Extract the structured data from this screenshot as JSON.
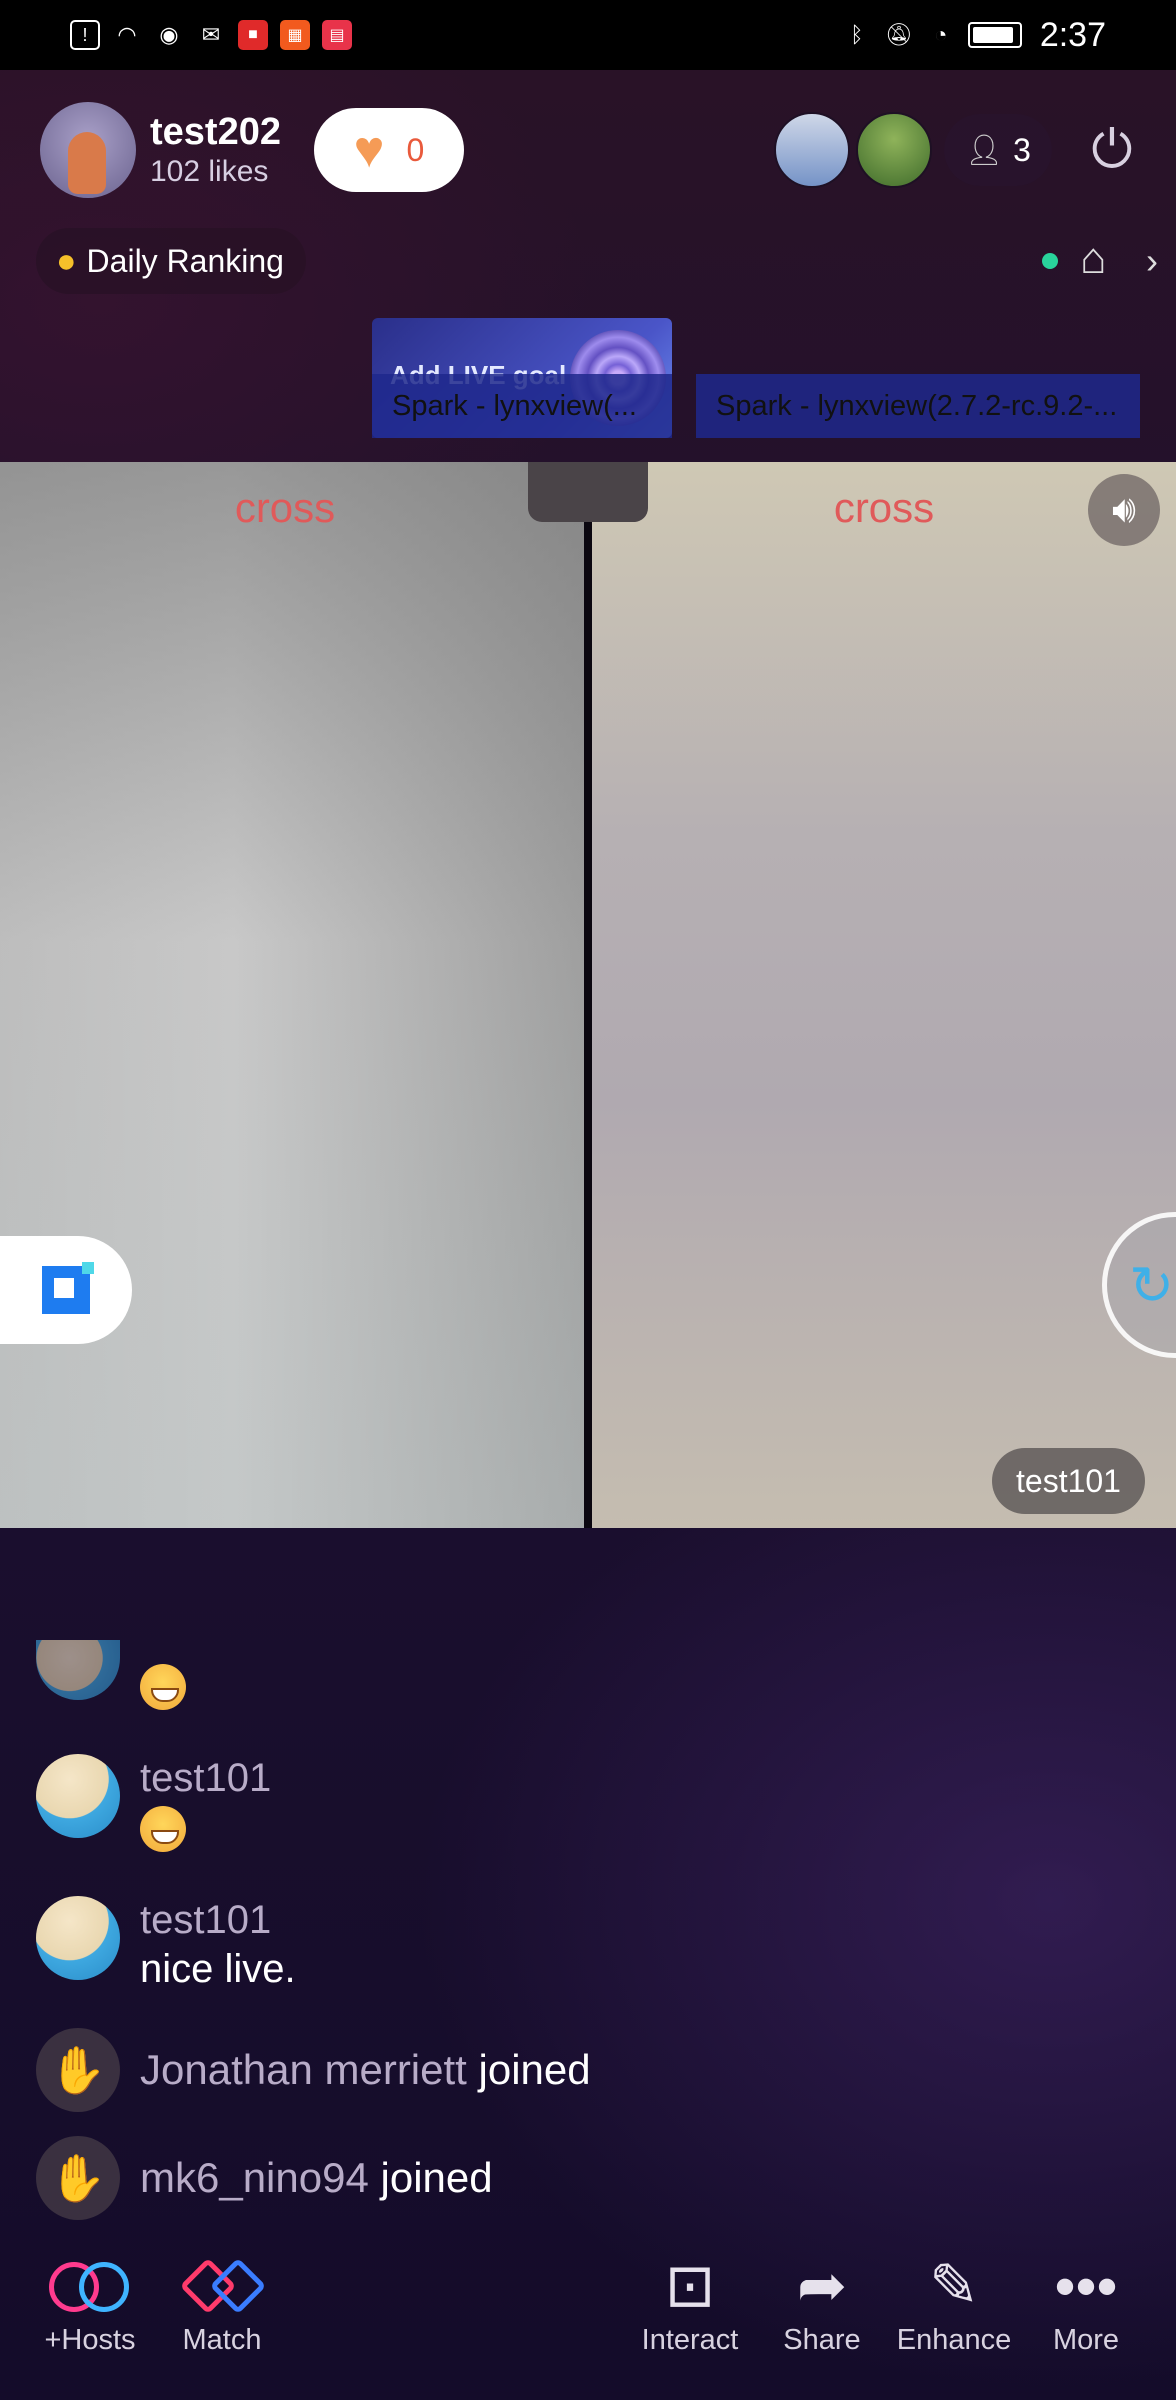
{
  "status_bar": {
    "time": "2:37",
    "left_icons": [
      "alert-icon",
      "wifi-icon",
      "eye-icon",
      "mail-icon",
      "video-app-icon",
      "grid-app-icon",
      "book-app-icon"
    ],
    "right_icons": [
      "bluetooth-icon",
      "mute-icon",
      "speed-icon",
      "battery-icon"
    ]
  },
  "header": {
    "host_name": "test202",
    "likes": "102 likes",
    "like_count": "0",
    "viewer_count": "3",
    "ranking_label": "Daily Ranking"
  },
  "goal": {
    "title": "Add LIVE goal",
    "spark_left": "Spark - lynxview(...",
    "spark_right": "Spark - lynxview(2.7.2-rc.9.2-..."
  },
  "video": {
    "left_label": "cross",
    "right_label": "cross",
    "guest_name": "test101"
  },
  "comments": [
    {
      "user": "",
      "text": ""
    },
    {
      "user": "test101",
      "text": ""
    },
    {
      "user": "test101",
      "text": "nice live."
    }
  ],
  "joins": [
    {
      "name": "Jonathan merriett",
      "verb": "joined"
    },
    {
      "name": "mk6_nino94",
      "verb": "joined"
    }
  ],
  "toolbar": {
    "hosts": "+Hosts",
    "match": "Match",
    "interact": "Interact",
    "share": "Share",
    "enhance": "Enhance",
    "more": "More"
  },
  "colors": {
    "accent_red": "#e05a5a",
    "like_orange": "#f59b56",
    "online_green": "#29d39b"
  }
}
